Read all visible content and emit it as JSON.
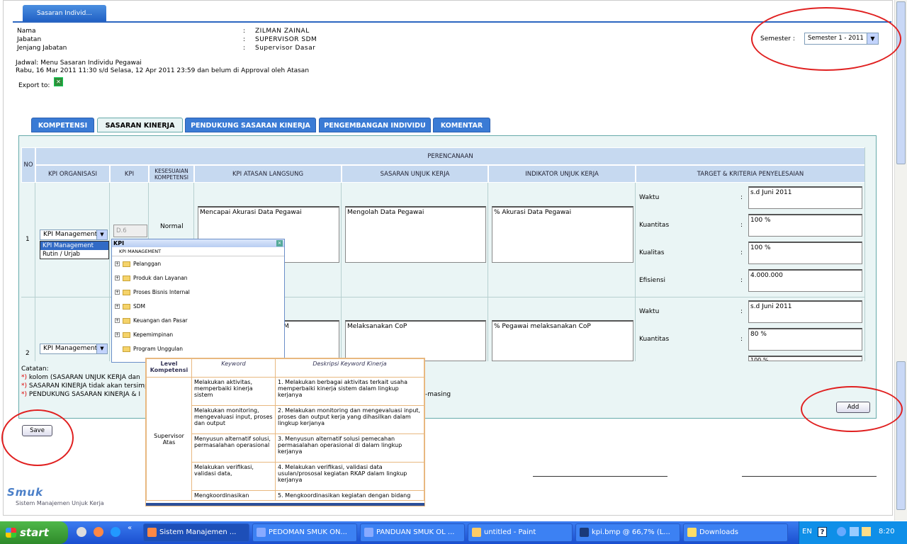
{
  "top_tab": "Sasaran Individ...",
  "info": {
    "name_label": "Nama",
    "name_value": "ZILMAN ZAINAL",
    "jabatan_label": "Jabatan",
    "jabatan_value": "SUPERVISOR SDM",
    "jenjang_label": "Jenjang Jabatan",
    "jenjang_value": "Supervisor Dasar",
    "colon": ":"
  },
  "semester": {
    "label": "Semester :",
    "value": "Semester 1 - 2011"
  },
  "jadwal": {
    "line1": "Jadwal: Menu Sasaran Individu Pegawai",
    "line2": "Rabu, 16 Mar 2011 11:30 s/d Selasa, 12 Apr 2011 23:59 dan belum di Approval oleh Atasan"
  },
  "export_label": "Export to:",
  "tabs": [
    "KOMPETENSI",
    "SASARAN KINERJA",
    "PENDUKUNG SASARAN KINERJA",
    "PENGEMBANGAN INDIVIDU",
    "KOMENTAR"
  ],
  "table": {
    "no": "NO",
    "perencanaan": "PERENCANAAN",
    "cols": [
      "KPI ORGANISASI",
      "KPI",
      "KESESUAIAN KOMPETENSI",
      "KPI ATASAN LANGSUNG",
      "SASARAN UNJUK KERJA",
      "INDIKATOR UNJUK KERJA",
      "TARGET & KRITERIA PENYELESAIAN"
    ],
    "rows": [
      {
        "no": "1",
        "kpi_org": "KPI Management",
        "kpi": "D.6",
        "kesesuaian": "Normal",
        "atasan": "Mencapai Akurasi Data Pegawai",
        "sasaran": "Mengolah Data Pegawai",
        "indikator": "% Akurasi Data Pegawai",
        "targets": [
          {
            "label": "Waktu",
            "value": "s.d Juni 2011"
          },
          {
            "label": "Kuantitas",
            "value": "100 %"
          },
          {
            "label": "Kualitas",
            "value": "100 %"
          },
          {
            "label": "Efisiensi",
            "value": "4.000.000"
          }
        ]
      },
      {
        "no": "2",
        "kpi_org": "KPI Management",
        "atasan_partial": "M",
        "sasaran": "Melaksanakan CoP",
        "indikator": "% Pegawai melaksanakan CoP",
        "targets": [
          {
            "label": "Waktu",
            "value": "s.d Juni 2011"
          },
          {
            "label": "Kuantitas",
            "value": "80 %"
          },
          {
            "label": "Kualitas",
            "value": "100 %"
          }
        ]
      }
    ]
  },
  "dropdown_options": [
    "KPI Management",
    "Rutin / Urjab"
  ],
  "popup": {
    "title": "KPI",
    "header": "KPI MANAGEMENT",
    "items": [
      "Pelanggan",
      "Produk dan Layanan",
      "Proses Bisnis Internal",
      "SDM",
      "Keuangan dan Pasar",
      "Kepemimpinan",
      "Program Unggulan"
    ]
  },
  "catatan": {
    "title": "Catatan:",
    "lines": [
      "kolom (SASARAN UNJUK KERJA dan",
      "SASARAN KINERJA tidak akan tersimp",
      "PENDUKUNG SASARAN KINERJA & I"
    ],
    "tail": "-masing"
  },
  "keyword_table": {
    "headers": [
      "Level Kompetensi",
      "Keyword",
      "Deskripsi Keyword Kinerja"
    ],
    "level": "Supervisor Atas",
    "rows": [
      {
        "kw": "Melakukan aktivitas, memperbaiki kinerja sistem",
        "desc": "1. Melakukan berbagai aktivitas terkait usaha memperbaiki kinerja sistem dalam lingkup kerjanya"
      },
      {
        "kw": "Melakukan monitoring, mengevaluasi input, proses dan output",
        "desc": "2. Melakukan monitoring dan mengevaluasi input, proses dan output kerja yang dihasilkan dalam lingkup kerjanya"
      },
      {
        "kw": "Menyusun alternatif solusi, permasalahan operasional",
        "desc": "3. Menyusun alternatif solusi pemecahan permasalahan operasional di dalam lingkup kerjanya"
      },
      {
        "kw": "Melakukan verifikasi, validasi data,",
        "desc": "4. Melakukan verifikasi, validasi data usulan/prososal kegiatan RKAP dalam lingkup kerjanya"
      },
      {
        "kw": "Mengkoordinasikan",
        "desc": "5. Mengkoordinasikan kegiatan dengan bidang"
      }
    ]
  },
  "buttons": {
    "save": "Save",
    "add": "Add"
  },
  "logo": {
    "text": "Smuk",
    "subtitle": "Sistem Manajemen Unjuk Kerja"
  },
  "taskbar": {
    "start": "start",
    "items": [
      "Sistem Manajemen ...",
      "PEDOMAN SMUK ON...",
      "PANDUAN SMUK OL ...",
      "untitled - Paint",
      "kpi.bmp @ 66,7% (L...",
      "Downloads"
    ],
    "lang": "EN",
    "clock": "8:20"
  }
}
